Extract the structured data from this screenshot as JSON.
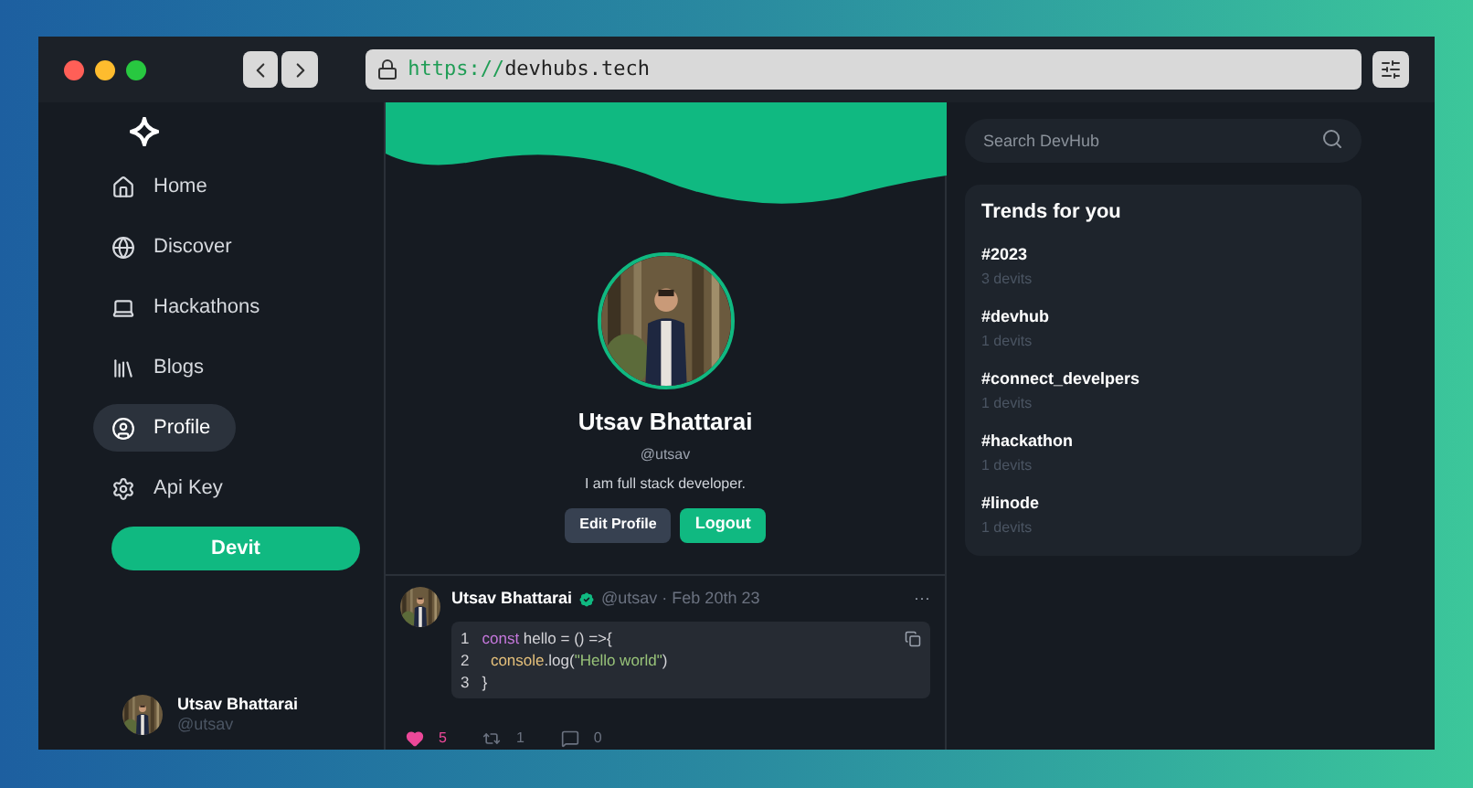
{
  "browser": {
    "url": {
      "scheme": "https://",
      "host": "devhubs.tech"
    }
  },
  "sidebar": {
    "items": [
      {
        "label": "Home",
        "selected": false
      },
      {
        "label": "Discover",
        "selected": false
      },
      {
        "label": "Hackathons",
        "selected": false
      },
      {
        "label": "Blogs",
        "selected": false
      },
      {
        "label": "Profile",
        "selected": true
      },
      {
        "label": "Api Key",
        "selected": false
      }
    ],
    "button": "Devit",
    "user": {
      "name": "Utsav Bhattarai",
      "handle": "@utsav"
    }
  },
  "profile": {
    "name": "Utsav Bhattarai",
    "handle": "@utsav",
    "bio": "I am full stack developer.",
    "buttons": [
      "Edit Profile",
      "Logout"
    ]
  },
  "post": {
    "author": "Utsav Bhattarai",
    "verified": true,
    "meta": "@utsav · Feb 20th 23",
    "more": "···",
    "code": [
      {
        "number": "1",
        "tokens": [
          {
            "text": "const",
            "kind": "keyword"
          },
          {
            "text": " hello = () =>{",
            "kind": "plain"
          }
        ]
      },
      {
        "number": "2",
        "tokens": [
          {
            "text": "  console",
            "kind": "object"
          },
          {
            "text": ".log(",
            "kind": "plain"
          },
          {
            "text": "\"Hello world\"",
            "kind": "string"
          },
          {
            "text": ")",
            "kind": "plain"
          }
        ]
      },
      {
        "number": "3",
        "tokens": [
          {
            "text": "}",
            "kind": "plain"
          }
        ]
      }
    ],
    "likes": {
      "count": "5",
      "liked": true
    },
    "reposts": "1",
    "comments": "0"
  },
  "search": {
    "placeholder": "Search DevHub"
  },
  "trends": {
    "title": "Trends for you",
    "items": [
      {
        "tag": "#2023",
        "count": "3 devits"
      },
      {
        "tag": "#devhub",
        "count": "1 devits"
      },
      {
        "tag": "#connect_develpers",
        "count": "1 devits"
      },
      {
        "tag": "#hackathon",
        "count": "1 devits"
      },
      {
        "tag": "#linode",
        "count": "1 devits"
      }
    ]
  }
}
